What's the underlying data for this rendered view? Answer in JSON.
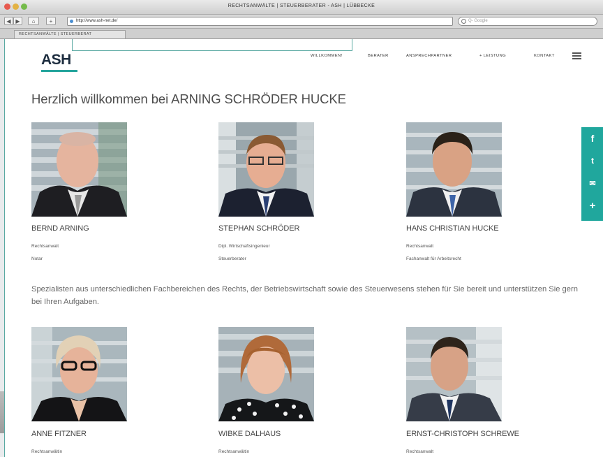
{
  "window": {
    "title": "RECHTSANWÄLTE | STEUERBERATER - ASH | LÜBBECKE"
  },
  "browser": {
    "back": "◀",
    "forward": "▶",
    "home": "⌂",
    "add": "+",
    "url": "http://www.ash-net.de/",
    "reload": "↻",
    "search_placeholder": "Q- Google",
    "tab_label": "RECHTSANWÄLTE | STEUERBERAT"
  },
  "site": {
    "logo": "ASH",
    "nav": [
      "WILLKOMMEN!",
      "BERATER",
      "ANSPRECHPARTNER",
      "+ LEISTUNG",
      "KONTAKT"
    ],
    "headline": "Herzlich willkommen bei ARNING SCHRÖDER HUCKE",
    "intro": "Spezialisten aus unterschiedlichen Fachbereichen des Rechts, der Betriebswirtschaft sowie des Steuerwesens stehen für Sie bereit und unterstützen Sie gern bei Ihren Aufgaben.",
    "people": [
      {
        "name": "BERND ARNING",
        "line1": "Rechtsanwalt",
        "line2": "Notar"
      },
      {
        "name": "STEPHAN SCHRÖDER",
        "line1": "Dipl. Wirtschaftsingenieur",
        "line2": "Steuerberater"
      },
      {
        "name": "HANS CHRISTIAN HUCKE",
        "line1": "Rechtsanwalt",
        "line2": "Fachanwalt für Arbeitsrecht"
      },
      {
        "name": "ANNE FITZNER",
        "line1": "Rechtsanwältin",
        "line2": ""
      },
      {
        "name": "WIBKE DALHAUS",
        "line1": "Rechtsanwältin",
        "line2": ""
      },
      {
        "name": "ERNST-CHRISTOPH SCHREWE",
        "line1": "Rechtsanwalt",
        "line2": ""
      }
    ],
    "social": [
      "f",
      "t",
      "✉",
      "+"
    ]
  },
  "colors": {
    "accent": "#20a79d",
    "logo": "#1d2d3f"
  }
}
